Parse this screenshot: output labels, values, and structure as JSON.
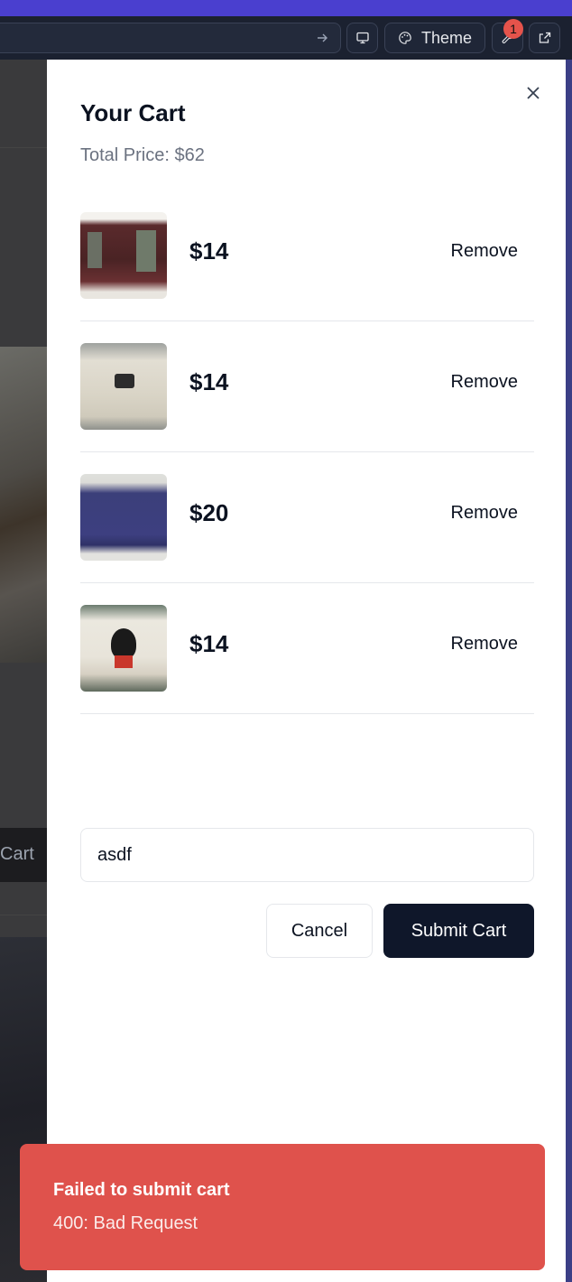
{
  "toolbar": {
    "theme_label": "Theme",
    "notification_count": "1"
  },
  "background_page": {
    "cart_button_label": "Cart"
  },
  "cart": {
    "title": "Your Cart",
    "total_price": "Total Price: $62",
    "items": [
      {
        "price": "$14",
        "remove_label": "Remove"
      },
      {
        "price": "$14",
        "remove_label": "Remove"
      },
      {
        "price": "$20",
        "remove_label": "Remove"
      },
      {
        "price": "$14",
        "remove_label": "Remove"
      }
    ],
    "note_value": "asdf",
    "cancel_label": "Cancel",
    "submit_label": "Submit Cart"
  },
  "toast": {
    "title": "Failed to submit cart",
    "description": "400: Bad Request"
  },
  "colors": {
    "accent_top": "#4a3fcf",
    "primary_button": "#0f172a",
    "toast_error": "#df524c"
  }
}
